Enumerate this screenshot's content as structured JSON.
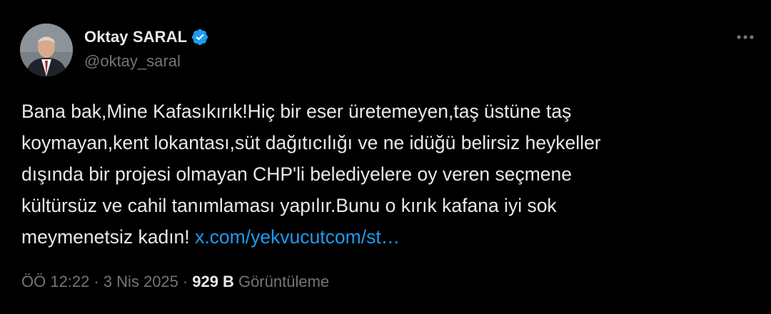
{
  "user": {
    "display_name": "Oktay SARAL",
    "handle": "@oktay_saral",
    "verified": true,
    "verified_color": "#1d9bf0"
  },
  "tweet": {
    "lines": [
      "Bana bak,Mine Kafasıkırık!Hiç bir eser üretemeyen,taş üstüne taş",
      "koymayan,kent lokantası,süt dağıtıcılığı ve ne idüğü belirsiz heykeller",
      "dışında bir projesi olmayan CHP'li belediyelere oy veren seçmene",
      "kültürsüz ve cahil tanımlaması yapılır.Bunu o kırık kafana iyi sok"
    ],
    "last_line_text": "meymenetsiz kadın!",
    "link_text": "x.com/yekvucutcom/st…"
  },
  "meta": {
    "time": "ÖÖ 12:22",
    "separator": "·",
    "date": "3 Nis 2025",
    "views_count": "929 B",
    "views_label": "Görüntüleme"
  },
  "icons": {
    "more": "more-horizontal-icon",
    "verified": "verified-badge-icon"
  },
  "colors": {
    "background": "#000000",
    "text": "#e7e9ea",
    "secondary": "#71767b",
    "link": "#1d9bf0"
  }
}
